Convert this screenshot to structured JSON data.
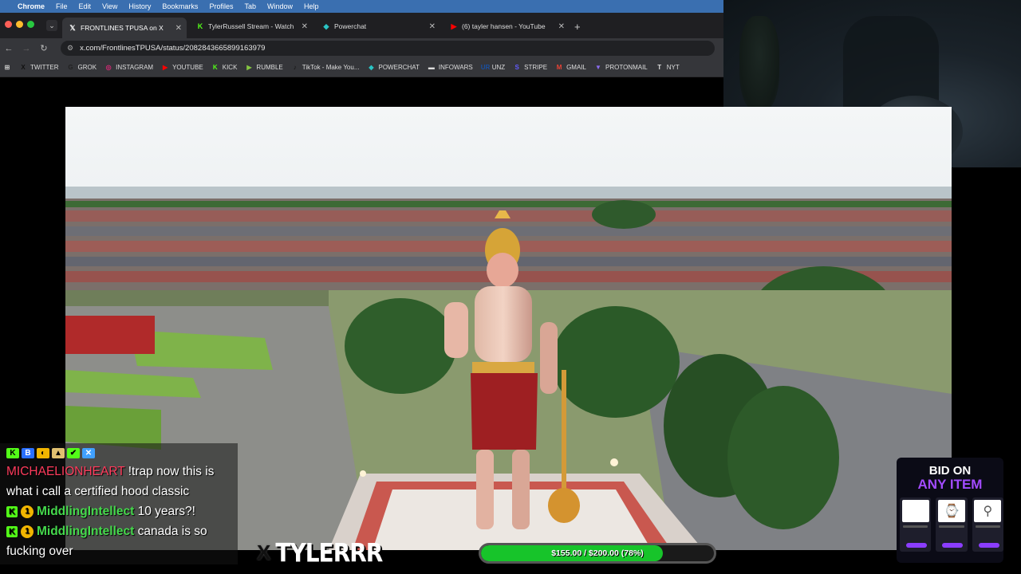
{
  "menubar": {
    "app": "Chrome",
    "items": [
      "File",
      "Edit",
      "View",
      "History",
      "Bookmarks",
      "Profiles",
      "Tab",
      "Window",
      "Help"
    ]
  },
  "tabs": [
    {
      "label": "FRONTLINES TPUSA on X",
      "icon": "x-icon",
      "active": true
    },
    {
      "label": "TylerRussell Stream - Watch",
      "icon": "kick-icon",
      "active": false
    },
    {
      "label": "Powerchat",
      "icon": "powerchat-icon",
      "active": false
    },
    {
      "label": "(6) tayler hansen - YouTube",
      "icon": "youtube-icon",
      "active": false
    }
  ],
  "address": {
    "url": "x.com/FrontlinesTPUSA/status/2082843665899163979"
  },
  "bookmarks": [
    {
      "label": "TWITTER",
      "icon": "X",
      "color": "#111111"
    },
    {
      "label": "GROK",
      "icon": "G",
      "color": "#222222"
    },
    {
      "label": "INSTAGRAM",
      "icon": "◎",
      "color": "#d62976"
    },
    {
      "label": "YOUTUBE",
      "icon": "▶",
      "color": "#ff0000"
    },
    {
      "label": "KICK",
      "icon": "K",
      "color": "#53fc18"
    },
    {
      "label": "RUMBLE",
      "icon": "▶",
      "color": "#85c742"
    },
    {
      "label": "TikTok - Make You...",
      "icon": "♪",
      "color": "#111111"
    },
    {
      "label": "POWERCHAT",
      "icon": "◆",
      "color": "#2ac4c4"
    },
    {
      "label": "INFOWARS",
      "icon": "▬",
      "color": "#dddddd"
    },
    {
      "label": "UNZ",
      "icon": "UR",
      "color": "#1a4fa0"
    },
    {
      "label": "STRIPE",
      "icon": "S",
      "color": "#635bff"
    },
    {
      "label": "GMAIL",
      "icon": "M",
      "color": "#ea4335"
    },
    {
      "label": "PROTONMAIL",
      "icon": "▼",
      "color": "#8a6cf0"
    },
    {
      "label": "NYT",
      "icon": "T",
      "color": "#dddddd"
    }
  ],
  "chat": {
    "messages": [
      {
        "user": "MICHAELIONHEART",
        "text": " !trap now this is what i call a certified hood classic",
        "style": "u1",
        "badges": false
      },
      {
        "user": "MiddlingIntellect",
        "text": " 10 years?!",
        "style": "u2",
        "badges": true
      },
      {
        "user": "MiddlingIntellect",
        "text": " canada is so fucking over",
        "style": "u2",
        "badges": true
      }
    ]
  },
  "logo": {
    "name": "TYLERRR"
  },
  "goal": {
    "label": "$155.00 / $200.00 (78%)",
    "progress": 0.78
  },
  "bid": {
    "line1": "BID ON",
    "line2": "ANY ITEM"
  },
  "colors": {
    "accent_green": "#17c42a",
    "kick_green": "#53fc18",
    "bid_purple": "#a24bff",
    "chat_red": "#ff3b5c",
    "chat_green": "#45d94c"
  }
}
